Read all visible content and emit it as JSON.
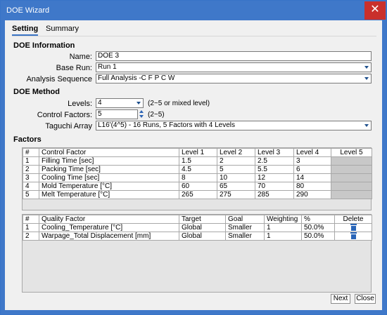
{
  "window": {
    "title": "DOE Wizard",
    "close_glyph": "✕"
  },
  "tabs": [
    {
      "label": "Setting",
      "active": true
    },
    {
      "label": "Summary",
      "active": false
    }
  ],
  "doe_info": {
    "section_title": "DOE Information",
    "name_label": "Name:",
    "name_value": "DOE 3",
    "base_run_label": "Base Run:",
    "base_run_value": "Run 1",
    "analysis_label": "Analysis Sequence",
    "analysis_value": "Full Analysis -C F P C W"
  },
  "doe_method": {
    "section_title": "DOE Method",
    "levels_label": "Levels:",
    "levels_value": "4",
    "levels_hint": "(2~5 or mixed level)",
    "control_factors_label": "Control Factors:",
    "control_factors_value": "5",
    "control_factors_hint": "(2~5)",
    "taguchi_label": "Taguchi Array",
    "taguchi_value": "L16'(4^5) - 16 Runs, 5 Factors with 4 Levels"
  },
  "factors": {
    "section_title": "Factors",
    "control_headers": [
      "#",
      "Control Factor",
      "Level 1",
      "Level 2",
      "Level 3",
      "Level 4",
      "Level 5"
    ],
    "control_rows": [
      [
        "1",
        "Filling Time [sec]",
        "1.5",
        "2",
        "2.5",
        "3",
        ""
      ],
      [
        "2",
        "Packing Time [sec]",
        "4.5",
        "5",
        "5.5",
        "6",
        ""
      ],
      [
        "3",
        "Cooling Time [sec]",
        "8",
        "10",
        "12",
        "14",
        ""
      ],
      [
        "4",
        "Mold Temperature [°C]",
        "60",
        "65",
        "70",
        "80",
        ""
      ],
      [
        "5",
        "Melt Temperature [°C]",
        "265",
        "275",
        "285",
        "290",
        ""
      ]
    ],
    "quality_headers": [
      "#",
      "Quality Factor",
      "Target",
      "Goal",
      "Weighting",
      "%",
      "Delete"
    ],
    "quality_rows": [
      [
        "1",
        "Cooling_Temperature [°C]",
        "Global",
        "Smaller",
        "1",
        "50.0%"
      ],
      [
        "2",
        "Warpage_Total Displacement [mm]",
        "Global",
        "Smaller",
        "1",
        "50.0%"
      ]
    ]
  },
  "buttons": {
    "next": "Next",
    "close": "Close"
  },
  "colors": {
    "title_bar": "#3f78c9",
    "close_button": "#c9302c",
    "accent": "#3a73c4"
  },
  "icons": {
    "delete": "trash-icon",
    "dropdown": "chevron-down-icon"
  }
}
